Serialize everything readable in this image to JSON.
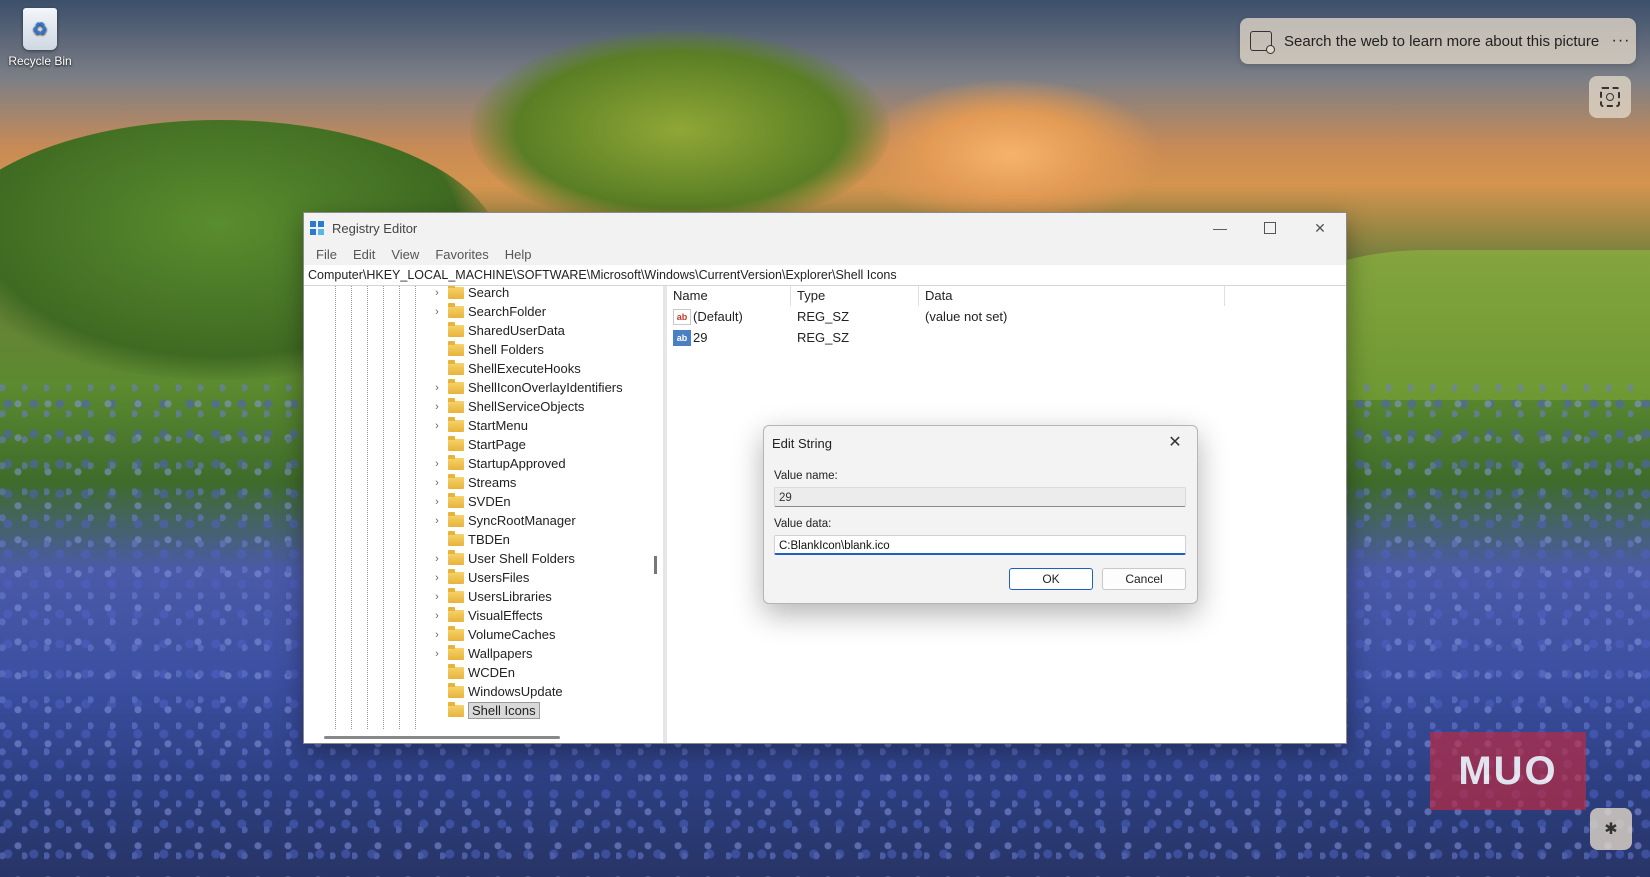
{
  "desktop": {
    "recycle_bin_label": "Recycle Bin",
    "search_prompt": "Search the web to learn more about this picture",
    "more_glyph": "···",
    "watermark": "MUO"
  },
  "window": {
    "title": "Registry Editor",
    "menu": [
      "File",
      "Edit",
      "View",
      "Favorites",
      "Help"
    ],
    "address": "Computer\\HKEY_LOCAL_MACHINE\\SOFTWARE\\Microsoft\\Windows\\CurrentVersion\\Explorer\\Shell Icons",
    "minimize_glyph": "—",
    "close_glyph": "✕"
  },
  "tree": {
    "items": [
      {
        "label": "Search",
        "expandable": true
      },
      {
        "label": "SearchFolder",
        "expandable": true
      },
      {
        "label": "SharedUserData",
        "expandable": false
      },
      {
        "label": "Shell Folders",
        "expandable": false
      },
      {
        "label": "ShellExecuteHooks",
        "expandable": false
      },
      {
        "label": "ShellIconOverlayIdentifiers",
        "expandable": true
      },
      {
        "label": "ShellServiceObjects",
        "expandable": true
      },
      {
        "label": "StartMenu",
        "expandable": true
      },
      {
        "label": "StartPage",
        "expandable": false
      },
      {
        "label": "StartupApproved",
        "expandable": true
      },
      {
        "label": "Streams",
        "expandable": true
      },
      {
        "label": "SVDEn",
        "expandable": true
      },
      {
        "label": "SyncRootManager",
        "expandable": true
      },
      {
        "label": "TBDEn",
        "expandable": false
      },
      {
        "label": "User Shell Folders",
        "expandable": true
      },
      {
        "label": "UsersFiles",
        "expandable": true
      },
      {
        "label": "UsersLibraries",
        "expandable": true
      },
      {
        "label": "VisualEffects",
        "expandable": true
      },
      {
        "label": "VolumeCaches",
        "expandable": true
      },
      {
        "label": "Wallpapers",
        "expandable": true
      },
      {
        "label": "WCDEn",
        "expandable": false
      },
      {
        "label": "WindowsUpdate",
        "expandable": false
      },
      {
        "label": "Shell Icons",
        "expandable": false,
        "selected": true
      }
    ]
  },
  "values_pane": {
    "columns": [
      "Name",
      "Type",
      "Data"
    ],
    "rows": [
      {
        "name": "(Default)",
        "type": "REG_SZ",
        "data": "(value not set)",
        "icon": "ab-string-icon"
      },
      {
        "name": "29",
        "type": "REG_SZ",
        "data": "",
        "icon": "ab-string-icon-selected"
      }
    ]
  },
  "dialog": {
    "title": "Edit String",
    "value_name_label": "Value name:",
    "value_name": "29",
    "value_data_label": "Value data:",
    "value_data": "C:BlankIcon\\blank.ico",
    "ok_label": "OK",
    "cancel_label": "Cancel",
    "close_glyph": "✕"
  }
}
